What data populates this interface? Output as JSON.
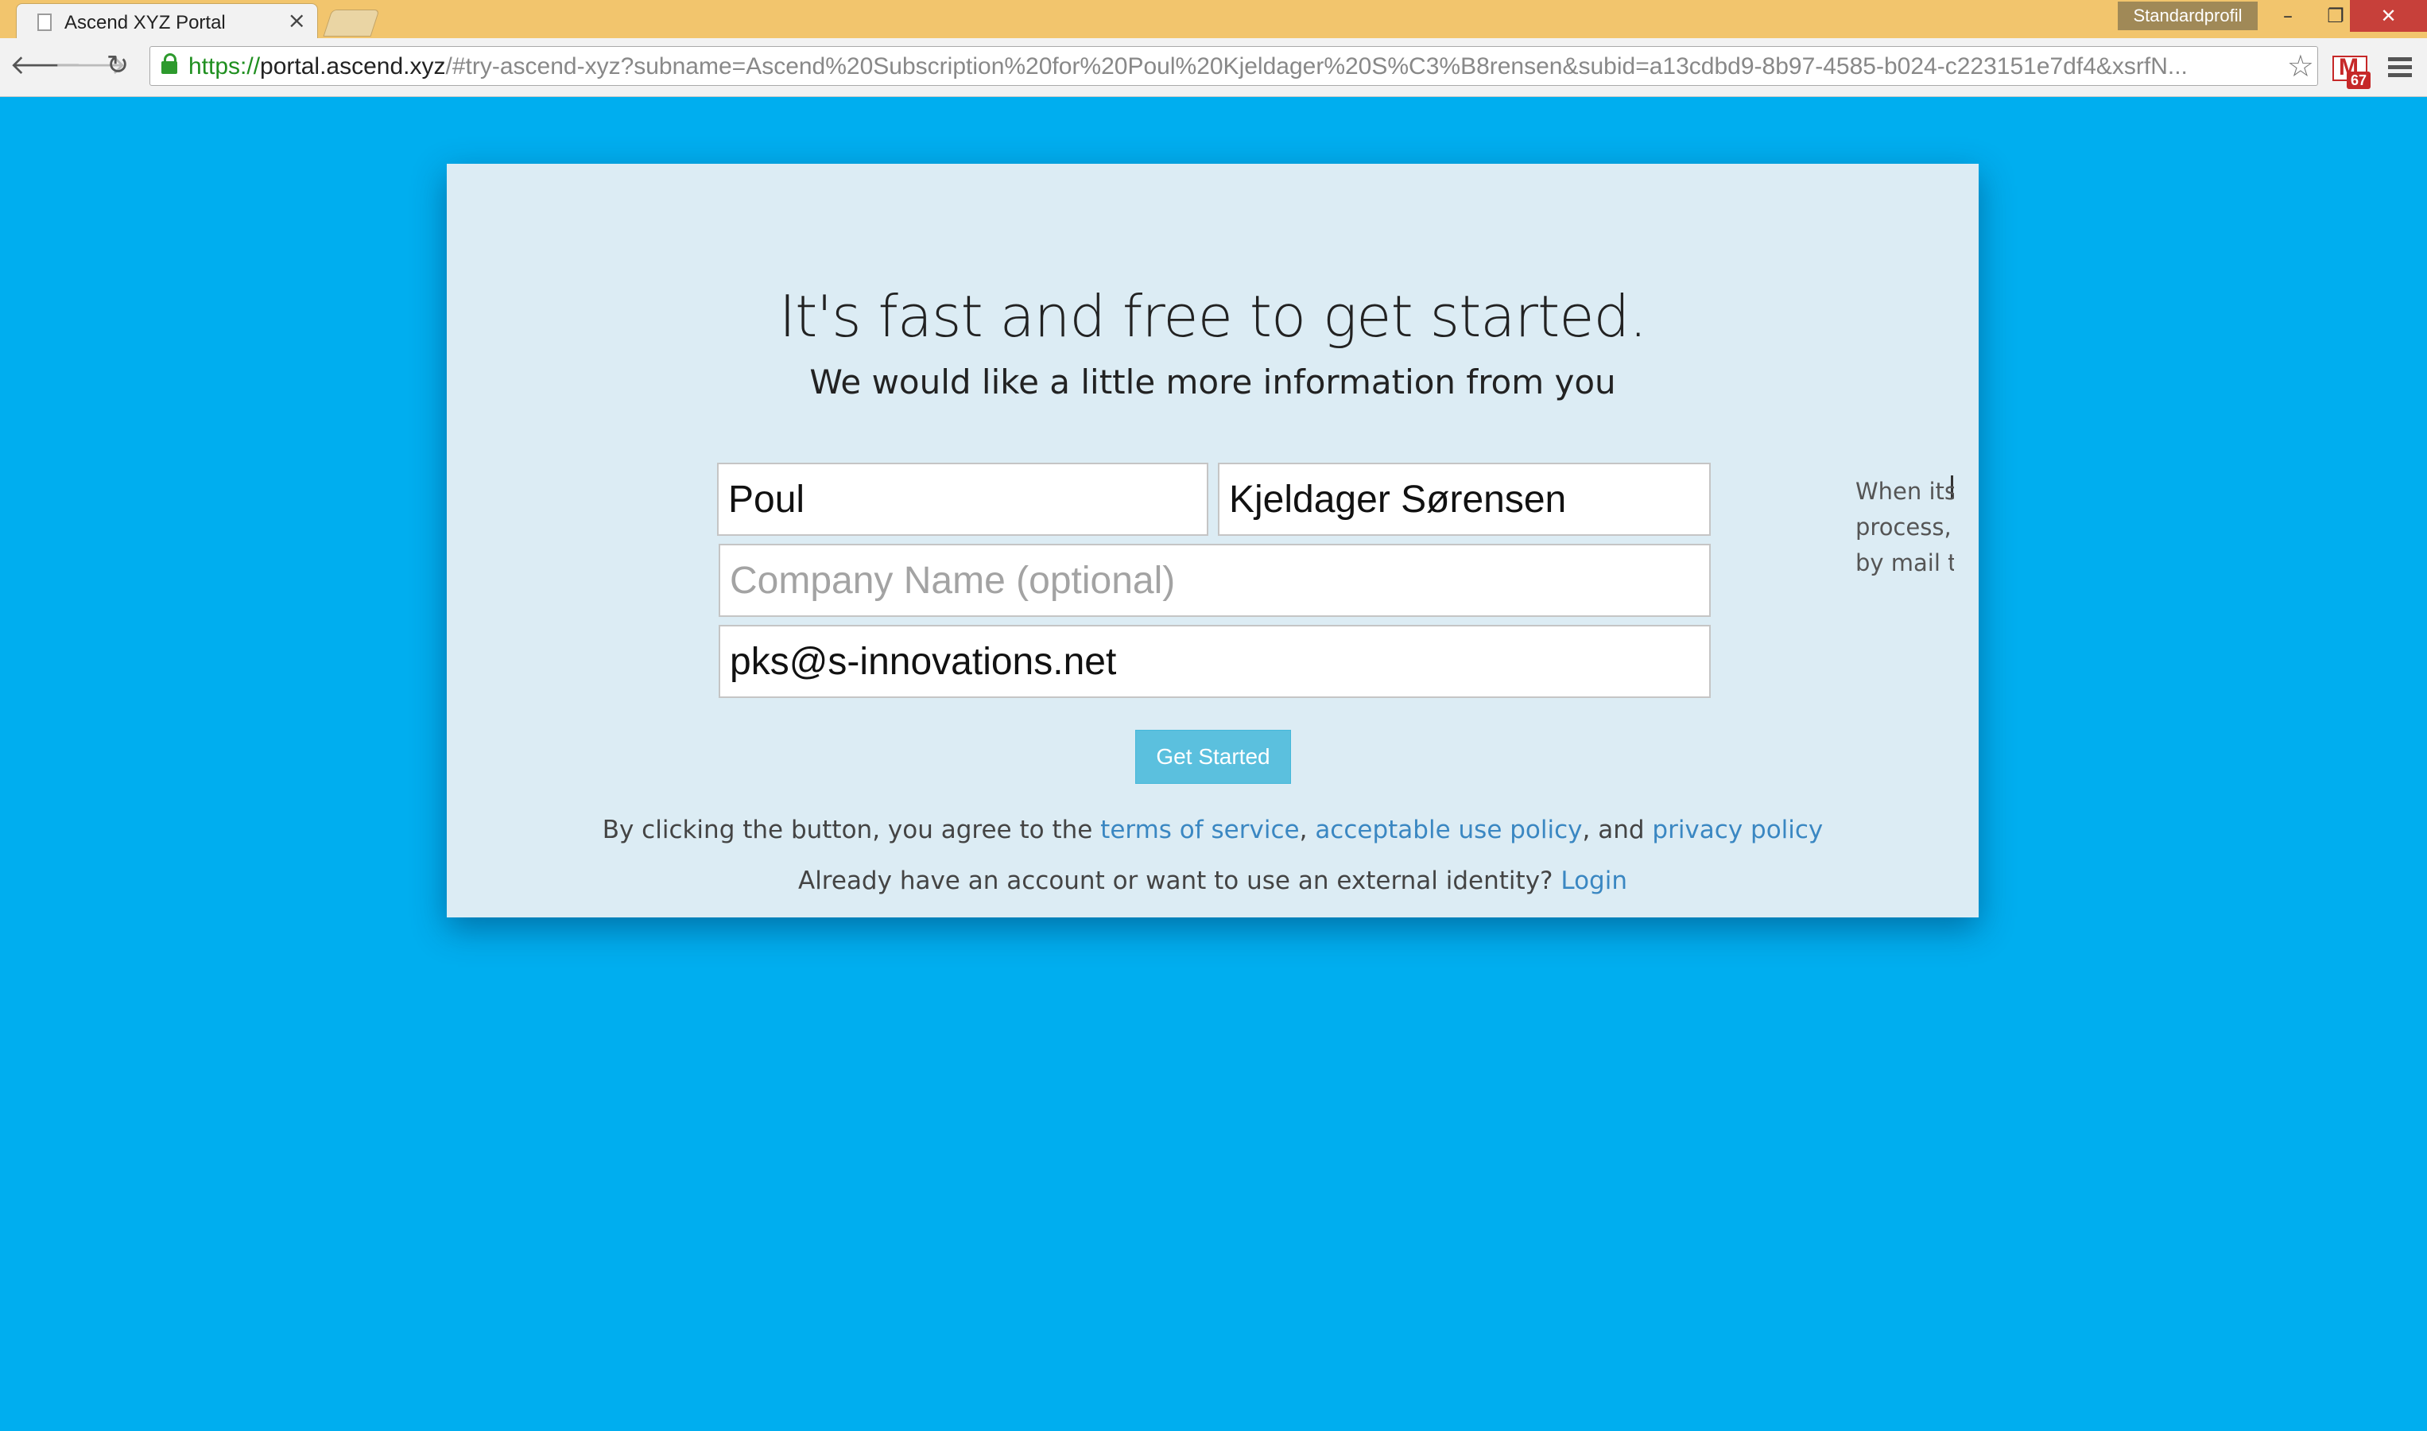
{
  "browser": {
    "tab_title": "Ascend XYZ Portal",
    "tab_close": "×",
    "profile_label": "Standardprofil",
    "window_controls": {
      "minimize": "–",
      "maximize": "❐",
      "close": "✕"
    },
    "nav": {
      "back": "🡐",
      "forward": "🡒",
      "reload": "↻"
    },
    "url": {
      "scheme": "https://",
      "host": "portal.ascend.xyz",
      "rest": "/#try-ascend-xyz?subname=Ascend%20Subscription%20for%20Poul%20Kjeldager%20S%C3%B8rensen&subid=a13cdbd9-8b97-4585-b024-c223151e7df4&xsrfN..."
    },
    "star": "☆",
    "gmail_badge": "67"
  },
  "form": {
    "heading": "It's fast and free to get started.",
    "subheading": "We would like a little more information from you",
    "first_name": {
      "value": "Poul"
    },
    "last_name": {
      "value": "Kjeldager Sørensen"
    },
    "company": {
      "value": "",
      "placeholder": "Company Name (optional)"
    },
    "email": {
      "value": "pks@s-innovations.net"
    },
    "submit_label": "Get Started",
    "legal": {
      "prefix": "By clicking the button, you agree to the ",
      "terms": "terms of service",
      "sep1": ", ",
      "aup": "acceptable use policy",
      "sep2": ", and ",
      "privacy": "privacy policy"
    },
    "login": {
      "prefix": "Already have an account or want to use an external identity? ",
      "link": "Login"
    }
  },
  "side_panel": {
    "lines": [
      "When its",
      "process, a",
      "by mail to"
    ]
  },
  "colors": {
    "page_background": "#00aeef",
    "card_background": "#dcecf4",
    "button": "#5bc0de",
    "link": "#3a87c2",
    "titlebar": "#f2c56d",
    "close_button": "#c7403a"
  }
}
